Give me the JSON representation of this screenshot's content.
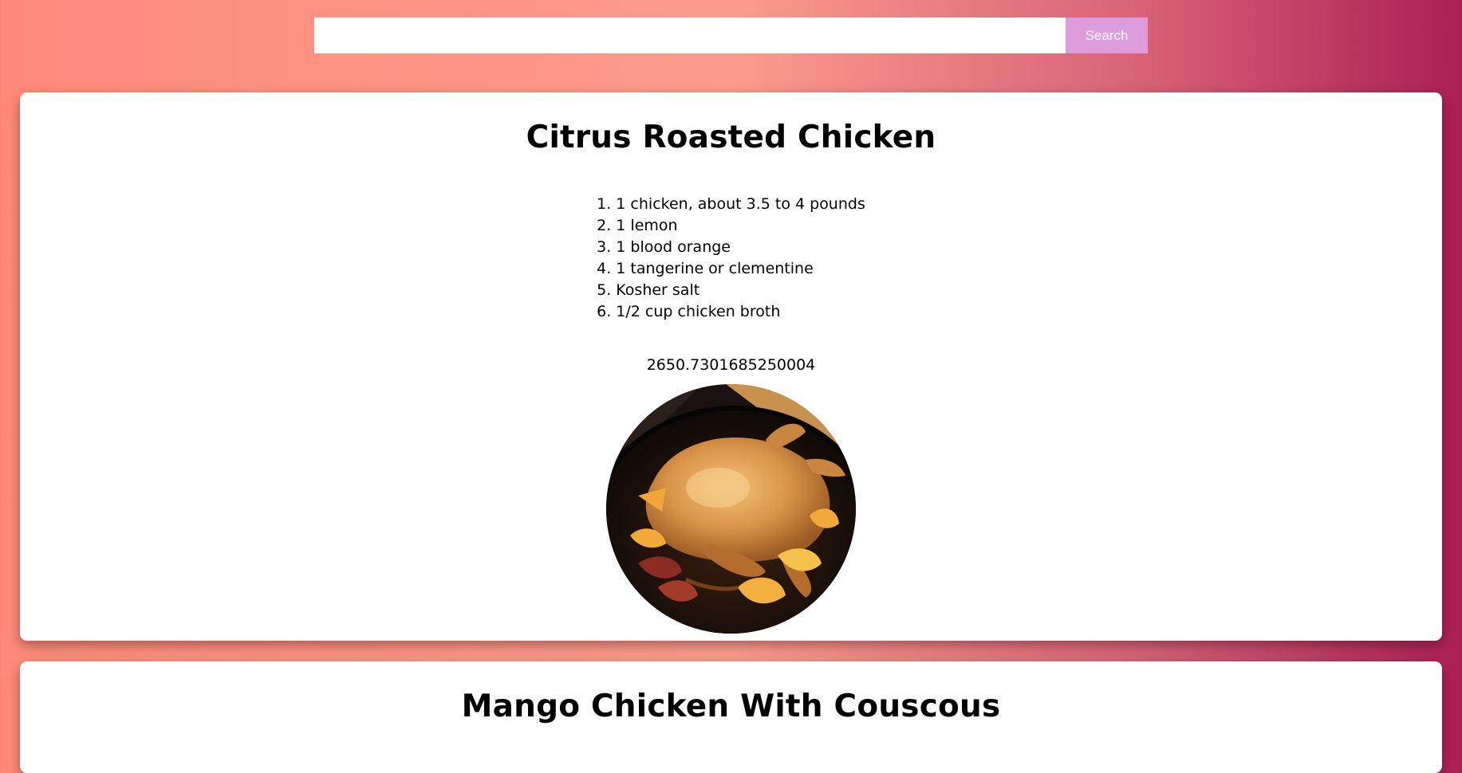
{
  "search": {
    "value": "",
    "placeholder": "",
    "button_label": "Search"
  },
  "recipes": [
    {
      "title": "Citrus Roasted Chicken",
      "ingredients": [
        "1. 1 chicken, about 3.5 to 4 pounds",
        "2. 1 lemon",
        "3. 1 blood orange",
        "4. 1 tangerine or clementine",
        "5. Kosher salt",
        "6. 1/2 cup chicken broth"
      ],
      "calories": "2650.7301685250004",
      "image_icon": "roasted-chicken-photo"
    },
    {
      "title": "Mango Chicken With Couscous"
    }
  ]
}
